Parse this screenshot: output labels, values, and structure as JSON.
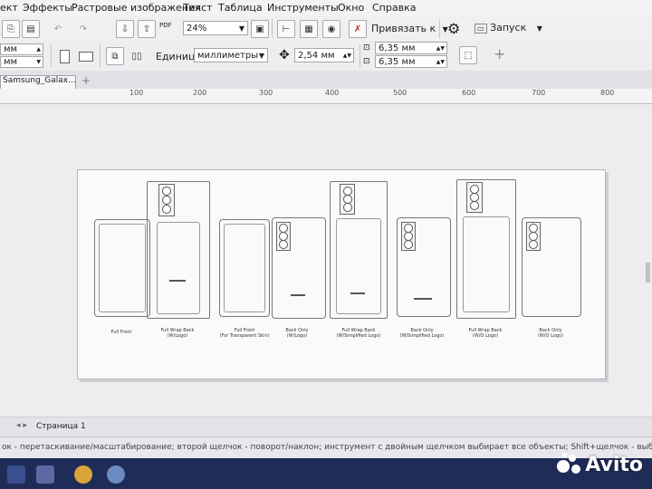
{
  "menu": {
    "items": [
      "ект",
      "Эффекты",
      "Растровые изображения",
      "Текст",
      "Таблица",
      "Инструменты",
      "Окно",
      "Справка"
    ]
  },
  "toolbar": {
    "zoom": "24%",
    "snap_label": "Привязать к",
    "launch_label": "Запуск",
    "pdf_label": "PDF",
    "size_width": "мм",
    "size_height": "мм",
    "units_label": "Единицы:",
    "units_value": "миллиметры",
    "nudge_value": "2,54 мм",
    "dup_x": "6,35 мм",
    "dup_y": "6,35 мм"
  },
  "document": {
    "tab_label": "Samsung_Galax..."
  },
  "ruler": {
    "ticks": [
      "100",
      "200",
      "300",
      "400",
      "500",
      "600",
      "700",
      "800"
    ]
  },
  "layouts": [
    {
      "line1": "Full Front",
      "line2": ""
    },
    {
      "line1": "Full Wrap Back",
      "line2": "(W/Logo)"
    },
    {
      "line1": "Full Front",
      "line2": "(For Transparent Skin)"
    },
    {
      "line1": "Back Only",
      "line2": "(W/Logo)"
    },
    {
      "line1": "Full Wrap Back",
      "line2": "(W/Simplified Logo)"
    },
    {
      "line1": "Back Only",
      "line2": "(W/Simplified Logo)"
    },
    {
      "line1": "Full Wrap Back",
      "line2": "(W/O Logo)"
    },
    {
      "line1": "Back Only",
      "line2": "(W/O Logo)"
    }
  ],
  "pages": {
    "page_label": "Страница 1"
  },
  "status": {
    "text": "ок - перетаскивание/масштабирование; второй щелчок - поворот/наклон; инструмент с двойным щелчком выбирает все объекты; Shift+щелчок - выбор неск"
  },
  "watermark": {
    "text": "Avito"
  },
  "colors": {
    "taskbar": "#1f2c57",
    "canvas": "#ededf0",
    "page": "#fafafa"
  }
}
